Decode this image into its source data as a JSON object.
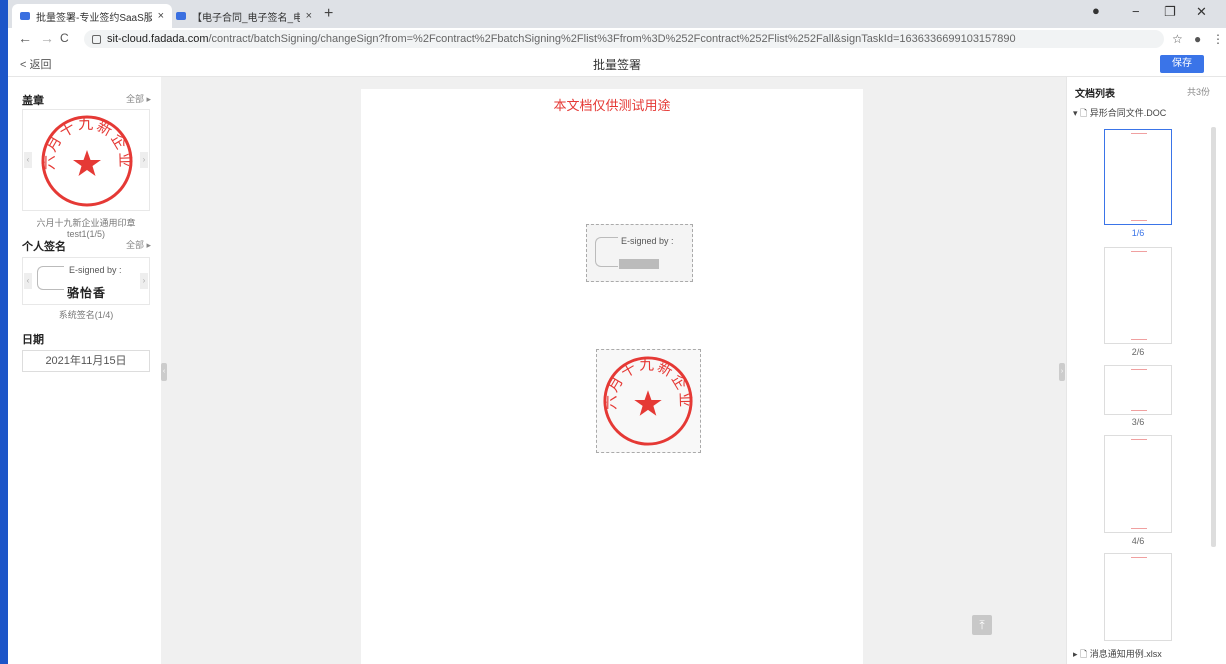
{
  "browser": {
    "tabs": [
      {
        "title": "批量签署-专业签约SaaS服务平台",
        "close": "×"
      },
      {
        "title": "【电子合同_电子签名_电子印章】",
        "close": "×"
      }
    ],
    "new_tab": "+",
    "window_controls": {
      "minimize": "−",
      "maximize": "❐",
      "close": "✕"
    },
    "nav": {
      "back": "←",
      "forward": "→",
      "reload": "C"
    },
    "url_host": "sit-cloud.fadada.com",
    "url_path": "/contract/batchSigning/changeSign?from=%2Fcontract%2FbatchSigning%2Flist%3Ffrom%3D%252Fcontract%252Flist%252Fall&signTaskId=1636336699103157890"
  },
  "header": {
    "back_label": "< 返回",
    "title": "批量签署",
    "save_label": "保存"
  },
  "left": {
    "seal_section": "盖章",
    "all_label": "全部 ▸",
    "seal_text": "六月十九新企业",
    "seal_caption": "六月十九新企业通用印章test1(1/5)",
    "personal_section": "个人签名",
    "signature_label": "E-signed by :",
    "signature_name": "骆怡香",
    "signature_caption": "系统签名(1/4)",
    "date_section": "日期",
    "date_value": "2021年11月15日"
  },
  "document": {
    "watermark": "本文档仅供测试用途",
    "placed_signature_label": "E-signed by :",
    "seal_text": "六月十九新企业"
  },
  "right": {
    "title": "文档列表",
    "count": "共3份",
    "file1": "▾ 🗋 异形合同文件.DOC",
    "pages": [
      "1/6",
      "2/6",
      "3/6",
      "4/6"
    ],
    "file2": "▸ 🗋 消息通知用例.xlsx"
  },
  "colors": {
    "accent": "#3a74e8",
    "seal_red": "#e53935"
  }
}
